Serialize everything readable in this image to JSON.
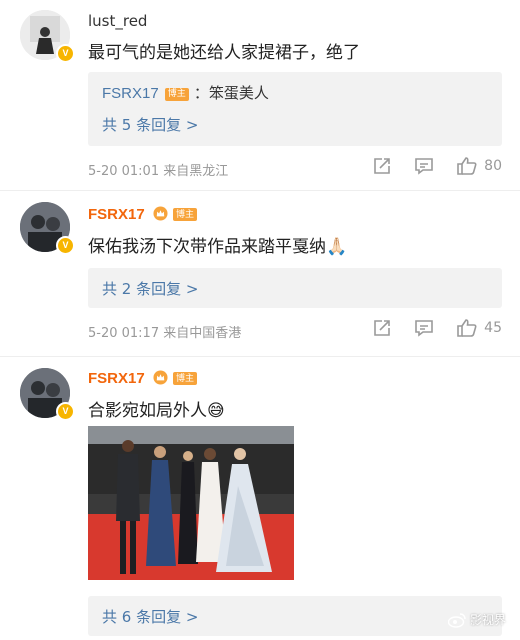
{
  "comments": [
    {
      "username": "lust_red",
      "text": "最可气的是她还给人家提裙子，绝了",
      "reply": {
        "author": "FSRX17",
        "owner_tag": "博主",
        "separator": "：",
        "text": "笨蛋美人",
        "more": "共 5 条回复 >"
      },
      "time": "5-20 01:01",
      "location": "来自黑龙江",
      "likes": "80"
    },
    {
      "username": "FSRX17",
      "owner_tag": "博主",
      "text": "保佑我汤下次带作品来踏平戛纳🙏🏻",
      "reply": {
        "more": "共 2 条回复 >"
      },
      "time": "5-20 01:17",
      "location": "来自中国香港",
      "likes": "45"
    },
    {
      "username": "FSRX17",
      "owner_tag": "博主",
      "text": "合影宛如局外人😅",
      "reply": {
        "more": "共 6 条回复 >"
      }
    }
  ],
  "icons": {
    "share": "share-icon",
    "comment": "comment-icon",
    "like": "thumbs-up-icon",
    "verified": "verified-v-icon",
    "crown": "crown-icon",
    "weibo": "weibo-logo-icon"
  },
  "colors": {
    "link_blue": "#4b78a8",
    "owner_orange": "#f2660c",
    "meta_gray": "#999999",
    "reply_bg": "#f2f2f2",
    "verified_yellow": "#f7b500"
  },
  "watermark": {
    "text": "影视界"
  }
}
